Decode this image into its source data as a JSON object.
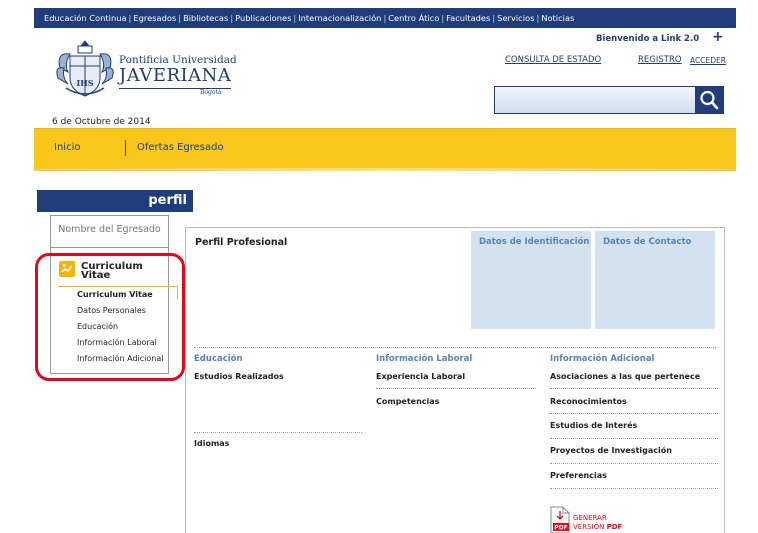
{
  "topnav": {
    "items": [
      "Educación Continua",
      "Egresados",
      "Bibliotecas",
      "Publicaciones",
      "Internacionalización",
      "Centro Ático",
      "Facultades",
      "Servicios",
      "Noticias"
    ],
    "separator": "|"
  },
  "logo": {
    "line1": "Pontificia Universidad",
    "line2": "JAVERIANA",
    "line3": "Bogotá",
    "seal_text": "IHS"
  },
  "header": {
    "welcome": "Bienvenido a Link 2.0",
    "plus": "+",
    "consulta": "CONSULTA DE ESTADO",
    "registro": "REGISTRO",
    "acceder": "ACCEDER",
    "search_value": ""
  },
  "date": "6 de Octubre de 2014",
  "breadcrumb": {
    "inicio": "Inicio",
    "ofertas": "Ofertas Egresado"
  },
  "perfil_label": "perfil",
  "sidebar": {
    "name": "Nombre del Egresado",
    "cv_title_1": "Curriculum",
    "cv_title_2": "Vitae",
    "items": [
      "Curriculum Vitae",
      "Datos Personales",
      "Educación",
      "Información Laboral",
      "Información Adicional"
    ]
  },
  "main": {
    "perfil_profesional": "Perfil Profesional",
    "datos_identificacion": "Datos de Identificación",
    "datos_contacto": "Datos de Contacto",
    "educacion": {
      "heading": "Educación",
      "items": [
        "Estudios Realizados",
        "Idiomas"
      ]
    },
    "laboral": {
      "heading": "Información Laboral",
      "items": [
        "Experiencia Laboral",
        "Competencias"
      ]
    },
    "adicional": {
      "heading": "Información Adicional",
      "items": [
        "Asociaciones a las que pertenece",
        "Reconocimientos",
        "Estudios de Interés",
        "Proyectos de Investigación",
        "Preferencias"
      ]
    },
    "pdf": {
      "line1": "GENERAR",
      "line2a": "VERSIÓN",
      "line2b": "PDF",
      "badge": "PDF"
    }
  },
  "colors": {
    "navy": "#1f3d7a",
    "yellow": "#f9c71a",
    "blue_box": "#d4e1ee",
    "highlight_red": "#e2081a"
  }
}
